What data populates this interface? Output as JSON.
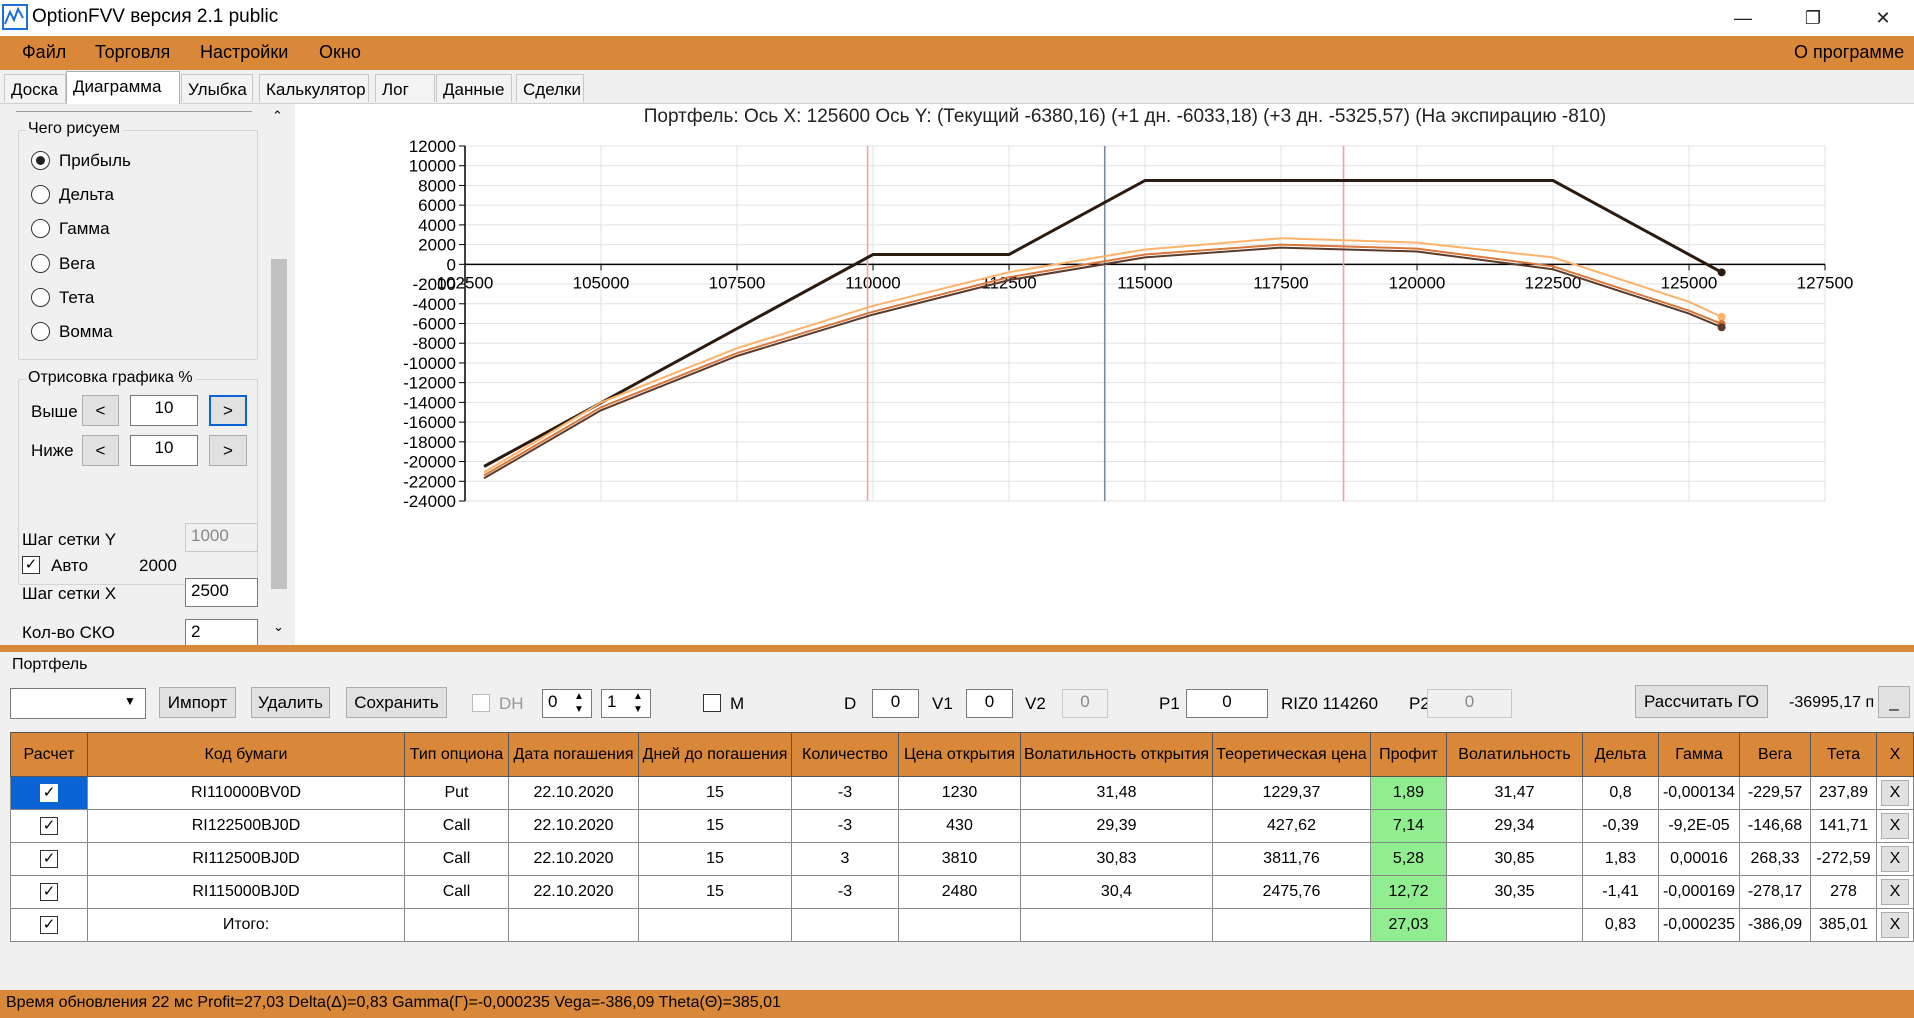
{
  "window": {
    "title": "OptionFVV версия 2.1 public",
    "minimize": "—",
    "maximize": "❐",
    "close": "✕"
  },
  "menu": {
    "items": [
      "Файл",
      "Торговля",
      "Настройки",
      "Окно"
    ],
    "about": "О программе"
  },
  "tabs": [
    "Доска",
    "Диаграмма",
    "Улыбка",
    "Калькулятор",
    "Лог",
    "Данные",
    "Сделки"
  ],
  "active_tab": "Диаграмма",
  "left_panel": {
    "draw_group_label": "Чего рисуем",
    "radios": [
      {
        "label": "Прибыль",
        "checked": true
      },
      {
        "label": "Дельта",
        "checked": false
      },
      {
        "label": "Гамма",
        "checked": false
      },
      {
        "label": "Вега",
        "checked": false
      },
      {
        "label": "Тета",
        "checked": false
      },
      {
        "label": "Вомма",
        "checked": false
      }
    ],
    "render_group_label": "Отрисовка графика %",
    "above_label": "Выше",
    "above_value": "10",
    "below_label": "Ниже",
    "below_value": "10",
    "dec_label": "<",
    "inc_label": ">",
    "grid_y_label": "Шаг сетки Y",
    "grid_y_value": "1000",
    "auto_label": "Авто",
    "auto_checked": true,
    "auto_value": "2000",
    "grid_x_label": "Шаг сетки X",
    "grid_x_value": "2500",
    "sko_label": "Кол-во СКО",
    "sko_value": "2"
  },
  "chart_data": {
    "type": "line",
    "title": "Портфель: Ось X: 125600 Ось Y:  (Текущий -6380,16)  (+1 дн. -6033,18)  (+3 дн. -5325,57)  (На экспирацию -810)",
    "xlim": [
      102500,
      127500
    ],
    "ylim": [
      -24000,
      12000
    ],
    "x_ticks": [
      102500,
      105000,
      107500,
      110000,
      112500,
      115000,
      117500,
      120000,
      122500,
      125000,
      127500
    ],
    "y_ticks": [
      12000,
      10000,
      8000,
      6000,
      4000,
      2000,
      0,
      -2000,
      -4000,
      -6000,
      -8000,
      -10000,
      -12000,
      -14000,
      -16000,
      -18000,
      -20000,
      -22000,
      -24000
    ],
    "grid": true,
    "vlines": [
      {
        "x": 109900,
        "color": "#f4a0a0"
      },
      {
        "x": 114260,
        "color": "#7a8a9a"
      },
      {
        "x": 118650,
        "color": "#f4a0a0"
      }
    ],
    "series": [
      {
        "color": "#2b1a10",
        "points": [
          [
            102850,
            -20500
          ],
          [
            110000,
            1000
          ],
          [
            112500,
            1000
          ],
          [
            115000,
            8500
          ],
          [
            122500,
            8500
          ],
          [
            125600,
            -810
          ]
        ]
      },
      {
        "color": "#ffb26a",
        "points": [
          [
            102850,
            -21100
          ],
          [
            105000,
            -14000
          ],
          [
            107500,
            -8500
          ],
          [
            110000,
            -4200
          ],
          [
            112500,
            -800
          ],
          [
            115000,
            1500
          ],
          [
            117500,
            2650
          ],
          [
            120000,
            2200
          ],
          [
            122500,
            700
          ],
          [
            125000,
            -3800
          ],
          [
            125600,
            -5326
          ]
        ]
      },
      {
        "color": "#d9773a",
        "points": [
          [
            102850,
            -21400
          ],
          [
            105000,
            -14500
          ],
          [
            107500,
            -9000
          ],
          [
            110000,
            -4800
          ],
          [
            112500,
            -1300
          ],
          [
            115000,
            1000
          ],
          [
            117500,
            2000
          ],
          [
            120000,
            1600
          ],
          [
            122500,
            -200
          ],
          [
            125000,
            -4700
          ],
          [
            125600,
            -6033
          ]
        ]
      },
      {
        "color": "#5a3a2a",
        "points": [
          [
            102850,
            -21700
          ],
          [
            105000,
            -14800
          ],
          [
            107500,
            -9300
          ],
          [
            110000,
            -5100
          ],
          [
            112500,
            -1600
          ],
          [
            115000,
            700
          ],
          [
            117500,
            1700
          ],
          [
            120000,
            1300
          ],
          [
            122500,
            -500
          ],
          [
            125000,
            -5000
          ],
          [
            125600,
            -6380
          ]
        ]
      }
    ]
  },
  "portfolio": {
    "label": "Портфель",
    "import_label": "Импорт",
    "delete_label": "Удалить",
    "save_label": "Сохранить",
    "dh_label": "DH",
    "spin1_value": "0",
    "spin2_value": "1",
    "m_label": "M",
    "d_label": "D",
    "d_value": "0",
    "v1_label": "V1",
    "v1_value": "0",
    "v2_label": "V2",
    "v2_value": "0",
    "p1_label": "P1",
    "p1_value": "0",
    "instrument": "RIZ0 114260",
    "p2_label": "P2",
    "p2_value": "0",
    "calc_go_label": "Рассчитать ГО",
    "go_value": "-36995,17 п",
    "collapse_label": "_"
  },
  "table": {
    "headers": [
      "Расчет",
      "Код бумаги",
      "Тип опциона",
      "Дата погашения",
      "Дней до погашения",
      "Количество",
      "Цена открытия",
      "Волатильность открытия",
      "Теоретическая цена",
      "Профит",
      "Волатильность",
      "Дельта",
      "Гамма",
      "Вега",
      "Тета",
      "X"
    ],
    "rows": [
      [
        "✓",
        "RI110000BV0D",
        "Put",
        "22.10.2020",
        "15",
        "-3",
        "1230",
        "31,48",
        "1229,37",
        "1,89",
        "31,47",
        "0,8",
        "-0,000134",
        "-229,57",
        "237,89",
        "X"
      ],
      [
        "✓",
        "RI122500BJ0D",
        "Call",
        "22.10.2020",
        "15",
        "-3",
        "430",
        "29,39",
        "427,62",
        "7,14",
        "29,34",
        "-0,39",
        "-9,2E-05",
        "-146,68",
        "141,71",
        "X"
      ],
      [
        "✓",
        "RI112500BJ0D",
        "Call",
        "22.10.2020",
        "15",
        "3",
        "3810",
        "30,83",
        "3811,76",
        "5,28",
        "30,85",
        "1,83",
        "0,00016",
        "268,33",
        "-272,59",
        "X"
      ],
      [
        "✓",
        "RI115000BJ0D",
        "Call",
        "22.10.2020",
        "15",
        "-3",
        "2480",
        "30,4",
        "2475,76",
        "12,72",
        "30,35",
        "-1,41",
        "-0,000169",
        "-278,17",
        "278",
        "X"
      ],
      [
        "✓",
        "Итого:",
        "",
        "",
        "",
        "",
        "",
        "",
        "",
        "27,03",
        "",
        "0,83",
        "-0,000235",
        "-386,09",
        "385,01",
        "X"
      ]
    ]
  },
  "status": "Время обновления 22 мс  Profit=27,03 Delta(Δ)=0,83 Gamma(Γ)=-0,000235 Vega=-386,09 Theta(Θ)=385,01"
}
